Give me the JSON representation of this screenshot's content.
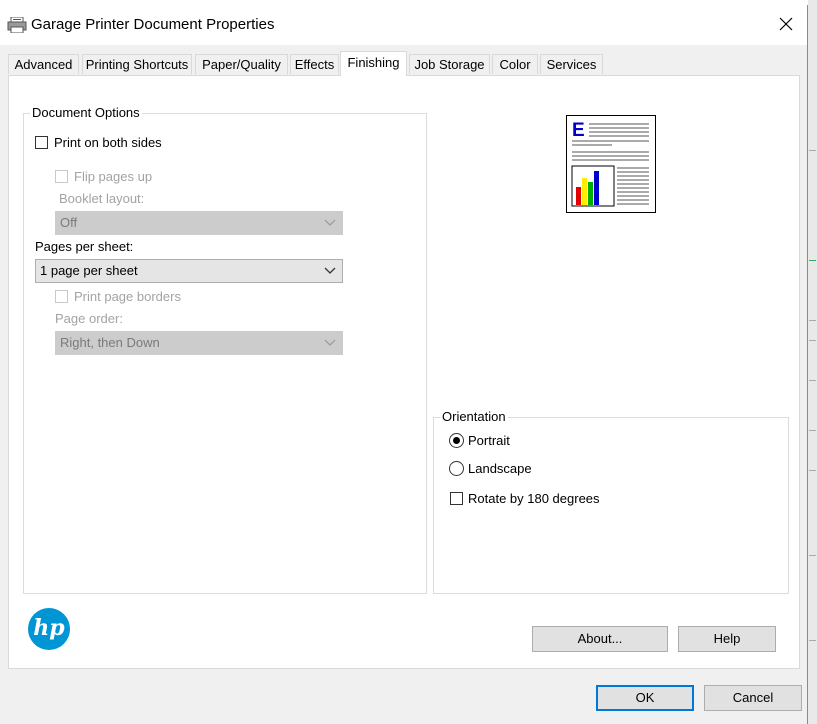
{
  "window": {
    "title": "Garage Printer Document Properties"
  },
  "tabs": [
    {
      "label": "Advanced"
    },
    {
      "label": "Printing Shortcuts"
    },
    {
      "label": "Paper/Quality"
    },
    {
      "label": "Effects"
    },
    {
      "label": "Finishing",
      "active": true
    },
    {
      "label": "Job Storage"
    },
    {
      "label": "Color"
    },
    {
      "label": "Services"
    }
  ],
  "document_options": {
    "legend": "Document Options",
    "print_both_sides": {
      "label": "Print on both sides",
      "checked": false
    },
    "flip_pages_up": {
      "label": "Flip pages up",
      "checked": false,
      "enabled": false
    },
    "booklet_layout": {
      "label": "Booklet layout:",
      "value": "Off",
      "enabled": false
    },
    "pages_per_sheet": {
      "label": "Pages per sheet:",
      "value": "1 page per sheet"
    },
    "print_page_borders": {
      "label": "Print page borders",
      "checked": false,
      "enabled": false
    },
    "page_order": {
      "label": "Page order:",
      "value": "Right, then Down",
      "enabled": false
    }
  },
  "preview": {
    "letter": "E"
  },
  "orientation": {
    "legend": "Orientation",
    "portrait": {
      "label": "Portrait",
      "selected": true
    },
    "landscape": {
      "label": "Landscape",
      "selected": false
    },
    "rotate": {
      "label": "Rotate by 180 degrees",
      "checked": false
    }
  },
  "logo": {
    "text": "hp"
  },
  "buttons": {
    "about": "About...",
    "help": "Help",
    "ok": "OK",
    "cancel": "Cancel"
  },
  "colors": {
    "accent": "#0078d7",
    "hp_blue": "#0096d6"
  }
}
